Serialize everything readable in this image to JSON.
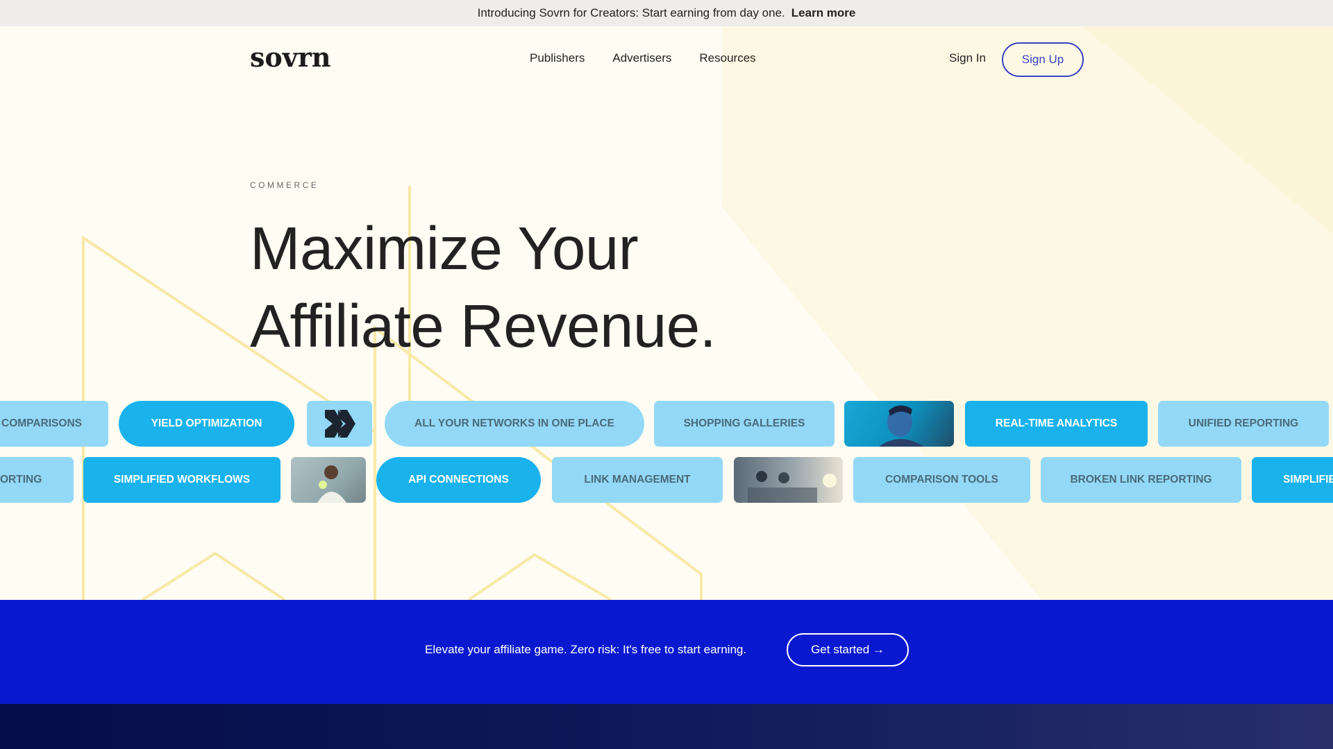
{
  "announcement": {
    "text": "Introducing Sovrn for Creators: Start earning from day one.",
    "link_label": "Learn more"
  },
  "nav": {
    "logo_text": "sovrn",
    "links": [
      "Publishers",
      "Advertisers",
      "Resources"
    ],
    "sign_in": "Sign In",
    "sign_up": "Sign Up"
  },
  "hero": {
    "eyebrow": "COMMERCE",
    "headline_line1": "Maximize Your",
    "headline_line2": "Affiliate Revenue."
  },
  "feature_row_1": [
    "COMPARISONS",
    "YIELD OPTIMIZATION",
    "ALL YOUR NETWORKS IN ONE PLACE",
    "SHOPPING GALLERIES",
    "REAL-TIME ANALYTICS",
    "UNIFIED REPORTING"
  ],
  "feature_row_2": [
    "ORTING",
    "SIMPLIFIED WORKFLOWS",
    "API CONNECTIONS",
    "LINK MANAGEMENT",
    "COMPARISON TOOLS",
    "BROKEN LINK REPORTING",
    "SIMPLIFIE"
  ],
  "cta": {
    "text": "Elevate your affiliate game. Zero risk: It's free to start earning.",
    "button": "Get started →"
  },
  "colors": {
    "brand_blue": "#0a19cf",
    "pill_dark": "#1ab2ec",
    "pill_light": "#93d9f7",
    "signup_border": "#3543c4",
    "background": "#fefcf3"
  }
}
